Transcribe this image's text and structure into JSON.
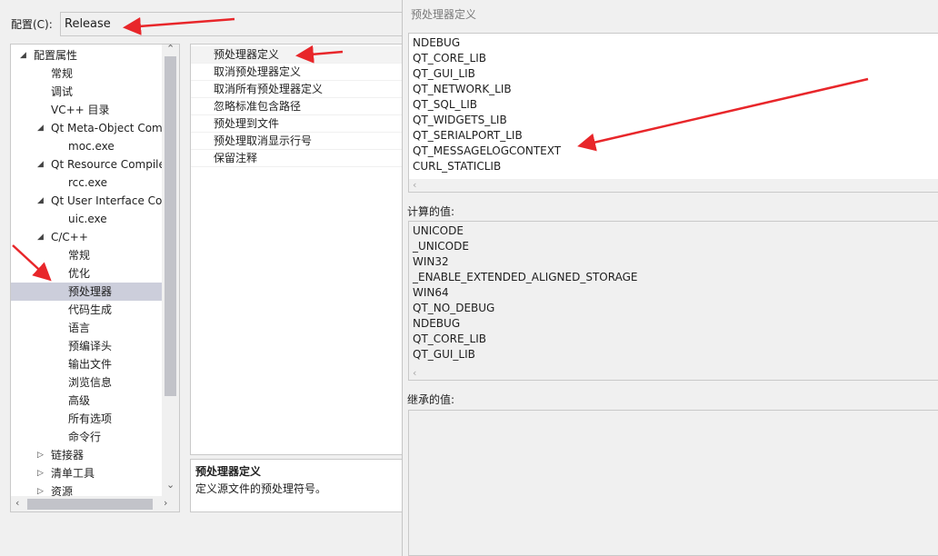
{
  "config": {
    "label": "配置(C):",
    "value": "Release"
  },
  "tree": [
    {
      "label": "配置属性",
      "toggle": "◢"
    },
    {
      "label": "常规"
    },
    {
      "label": "调试"
    },
    {
      "label": "VC++ 目录"
    },
    {
      "label": "Qt Meta-Object Com",
      "toggle": "◢"
    },
    {
      "label": "moc.exe"
    },
    {
      "label": "Qt Resource Compile",
      "toggle": "◢"
    },
    {
      "label": "rcc.exe"
    },
    {
      "label": "Qt User Interface Co",
      "toggle": "◢"
    },
    {
      "label": "uic.exe"
    },
    {
      "label": "C/C++",
      "toggle": "◢"
    },
    {
      "label": "常规"
    },
    {
      "label": "优化"
    },
    {
      "label": "预处理器",
      "selected": true
    },
    {
      "label": "代码生成"
    },
    {
      "label": "语言"
    },
    {
      "label": "预编译头"
    },
    {
      "label": "输出文件"
    },
    {
      "label": "浏览信息"
    },
    {
      "label": "高级"
    },
    {
      "label": "所有选项"
    },
    {
      "label": "命令行"
    },
    {
      "label": "链接器",
      "toggle": "▷"
    },
    {
      "label": "清单工具",
      "toggle": "▷"
    },
    {
      "label": "资源",
      "toggle": "▷"
    }
  ],
  "properties": [
    "预处理器定义",
    "取消预处理器定义",
    "取消所有预处理器定义",
    "忽略标准包含路径",
    "预处理到文件",
    "预处理取消显示行号",
    "保留注释"
  ],
  "description": {
    "title": "预处理器定义",
    "text": "定义源文件的预处理符号。"
  },
  "dialog": {
    "title": "预处理器定义",
    "definitions": [
      "NDEBUG",
      "QT_CORE_LIB",
      "QT_GUI_LIB",
      "QT_NETWORK_LIB",
      "QT_SQL_LIB",
      "QT_WIDGETS_LIB",
      "QT_SERIALPORT_LIB",
      "QT_MESSAGELOGCONTEXT",
      "CURL_STATICLIB"
    ],
    "evaluated_label": "计算的值:",
    "evaluated": [
      "UNICODE",
      "_UNICODE",
      "WIN32",
      "_ENABLE_EXTENDED_ALIGNED_STORAGE",
      "WIN64",
      "QT_NO_DEBUG",
      "NDEBUG",
      "QT_CORE_LIB",
      "QT_GUI_LIB"
    ],
    "inherited_label": "继承的值:"
  },
  "icons": {
    "expanded": "chevron-expanded-icon",
    "collapsed": "chevron-collapsed-icon",
    "scroll_left": "‹",
    "scroll_right": "›",
    "scroll_up": "⌃",
    "scroll_down": "⌄"
  },
  "colors": {
    "annotation": "#e8262a",
    "selection": "#cccedb"
  }
}
